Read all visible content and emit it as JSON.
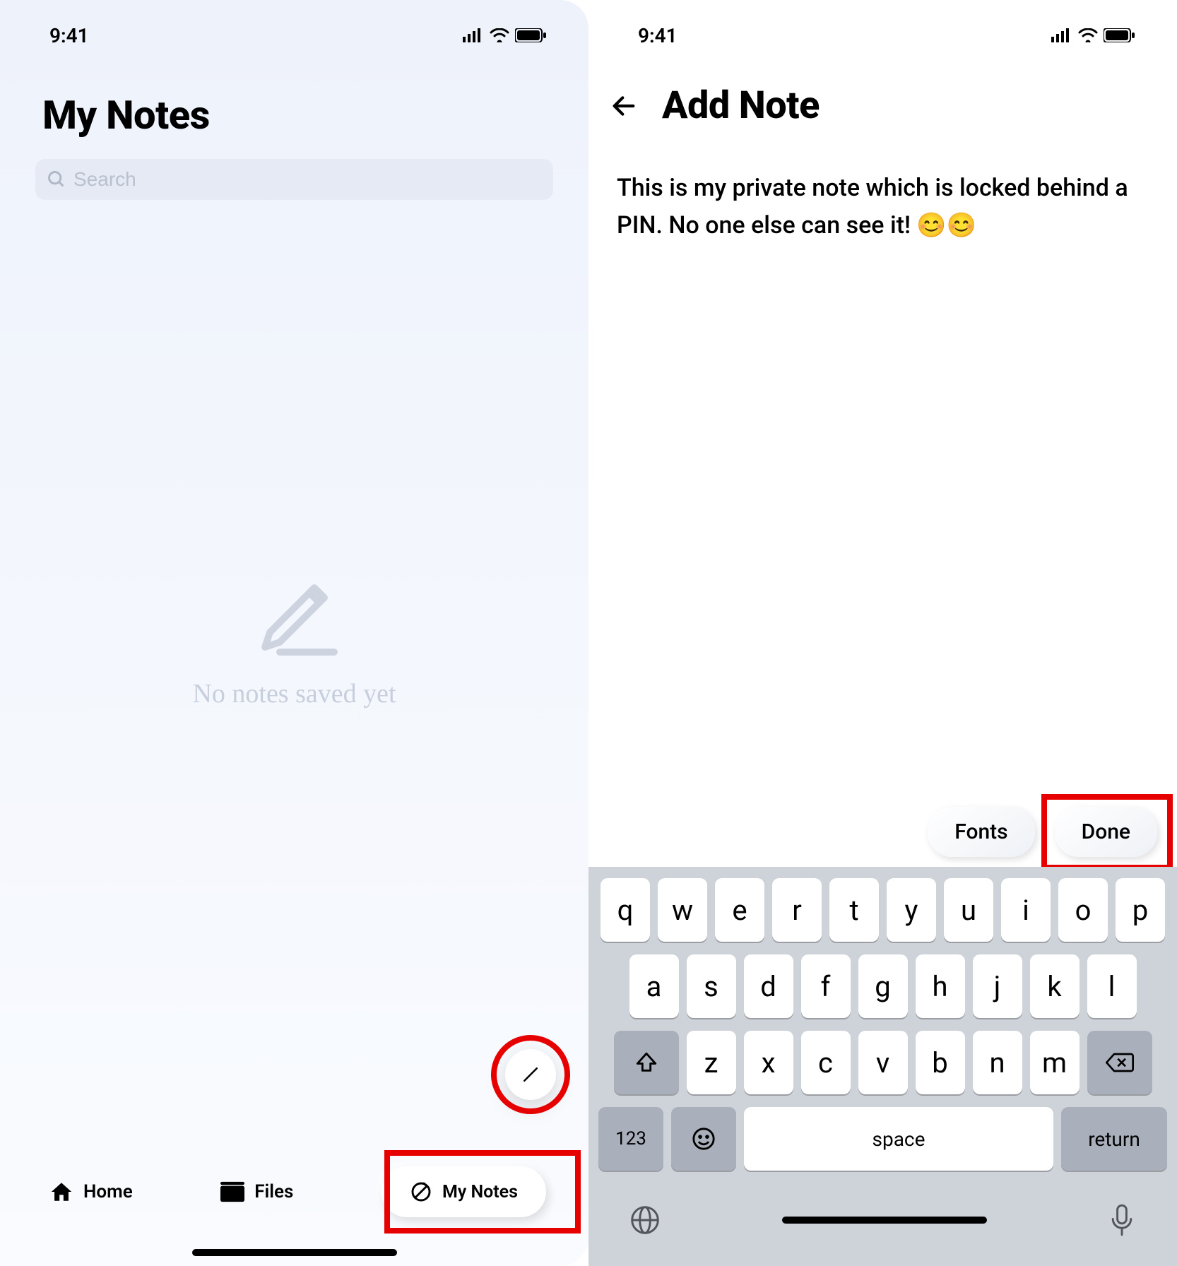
{
  "status": {
    "time": "9:41"
  },
  "left": {
    "title": "My Notes",
    "search_placeholder": "Search",
    "empty_text": "No notes saved yet",
    "tabs": {
      "home": "Home",
      "files": "Files",
      "mynotes": "My Notes"
    }
  },
  "right": {
    "title": "Add Note",
    "note_text": "This is my private note which is locked behind a PIN. No one else can see it! 😊😊",
    "toolbar": {
      "fonts": "Fonts",
      "done": "Done"
    }
  },
  "keyboard": {
    "row1": [
      "q",
      "w",
      "e",
      "r",
      "t",
      "y",
      "u",
      "i",
      "o",
      "p"
    ],
    "row2": [
      "a",
      "s",
      "d",
      "f",
      "g",
      "h",
      "j",
      "k",
      "l"
    ],
    "row3": [
      "z",
      "x",
      "c",
      "v",
      "b",
      "n",
      "m"
    ],
    "numbers": "123",
    "space": "space",
    "return": "return"
  }
}
